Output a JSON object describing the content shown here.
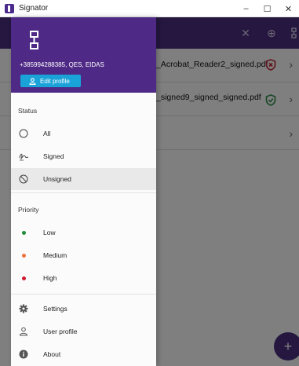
{
  "window": {
    "title": "Signator",
    "minimize": "–",
    "maximize": "☐",
    "close": "✕"
  },
  "app_header": {
    "close_icon": "✕",
    "globe_icon": "⊕"
  },
  "files": [
    {
      "name": "_Acrobat_Reader2_signed.pdf",
      "status": "invalid",
      "status_color": "#c0283a"
    },
    {
      "name": "_signed9_signed_signed.pdf",
      "status": "valid",
      "status_color": "#2e8b4a"
    },
    {
      "name": "",
      "status": "none"
    }
  ],
  "fab": {
    "label": "+"
  },
  "drawer": {
    "user": "+385994288385, QES, EIDAS",
    "edit_profile": "Edit profile",
    "status_title": "Status",
    "status_items": [
      {
        "label": "All",
        "icon": "circle-icon"
      },
      {
        "label": "Signed",
        "icon": "signature-icon"
      },
      {
        "label": "Unsigned",
        "icon": "block-icon",
        "selected": true
      }
    ],
    "priority_title": "Priority",
    "priority_items": [
      {
        "label": "Low",
        "color": "#1f8a3a"
      },
      {
        "label": "Medium",
        "color": "#f0703c"
      },
      {
        "label": "High",
        "color": "#d0182e"
      }
    ],
    "footer_items": [
      {
        "label": "Settings",
        "icon": "gear-icon"
      },
      {
        "label": "User profile",
        "icon": "user-icon"
      },
      {
        "label": "About",
        "icon": "info-icon"
      }
    ]
  }
}
